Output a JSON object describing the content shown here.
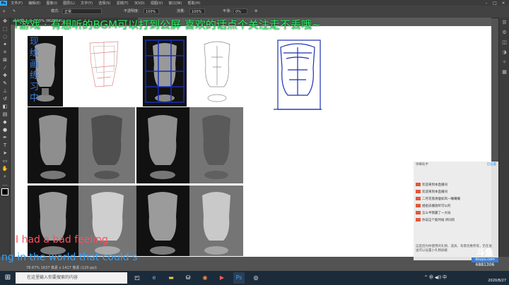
{
  "app": {
    "menus": [
      "文件(F)",
      "编辑(E)",
      "图像(I)",
      "图层(L)",
      "文字(Y)",
      "选择(S)",
      "滤镜(T)",
      "3D(D)",
      "视图(V)",
      "窗口(W)",
      "帮助(H)"
    ],
    "logo": "Ps"
  },
  "options": {
    "mode_label": "模式:",
    "mode_value": "正常",
    "opacity_label": "不透明度:",
    "opacity_value": "100%",
    "flow_label": "流量:",
    "flow_value": "100%",
    "smooth_label": "平滑:",
    "smooth_value": "0%"
  },
  "document": {
    "tab": "未标题-1 @ 78.5% (RGB/8#)"
  },
  "overlay": {
    "title": "T游戏 · 有想听的BGM可以打到公屏   喜欢的话点个关注走不丢哦~",
    "side_chars": [
      "现",
      "绘",
      "画",
      "练",
      "习",
      "中"
    ],
    "subtitle_line1": "I had a bad feeling",
    "subtitle_line2": "ng in the world that could s"
  },
  "statusbar": {
    "zoom": "78.67%",
    "info": "1637 像素 x 1417 像素 (120 ppi)"
  },
  "chat": {
    "header_left": "弹幕助手",
    "header_right": "已设置",
    "messages": [
      {
        "name": "",
        "text": "欢迎来到本直播间"
      },
      {
        "name": "",
        "text": "欢迎来到本直播间"
      },
      {
        "name": "",
        "text": "二月花落清瘦如风一曦曦曦"
      },
      {
        "name": "",
        "text": "姐姐去播放听可以的"
      },
      {
        "name": "",
        "text": "怎么半我赢了一大局"
      },
      {
        "name": "",
        "text": "你说这个能时候 听同的"
      }
    ],
    "footer": "这是因为你使用的礼物、道具、背景优惠券等，仍在发送可以设置小礼物屏蔽"
  },
  "watermark": {
    "brand": "斗鱼",
    "sub": "douyu.com",
    "room": "6881306"
  },
  "taskbar": {
    "start_icon": "windows-logo-icon",
    "search_placeholder": "在这里输入你要搜索的内容",
    "tray": "^ ㊥ ◀)) 中",
    "time": "2020/8/27"
  },
  "colors": {
    "overlay_title": "#2ee86b",
    "subtitle1": "#ff4f5e",
    "subtitle2": "#2fa3ff",
    "sketch_blue": "#1a2fb5",
    "taskbar": "#1b2b3a"
  }
}
